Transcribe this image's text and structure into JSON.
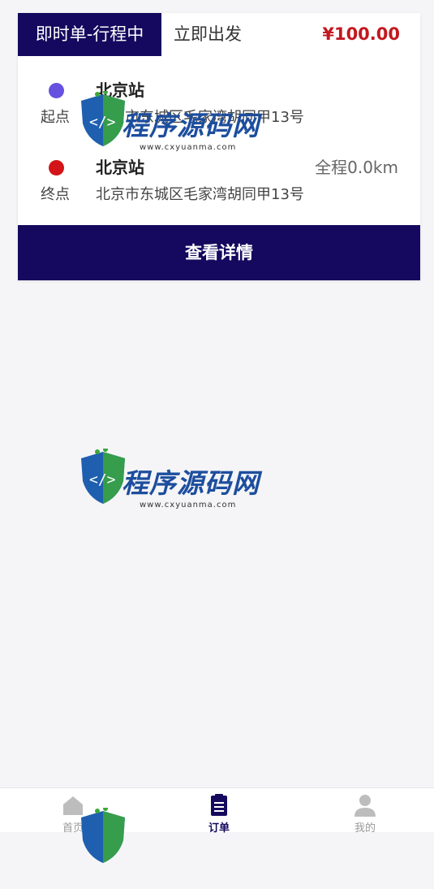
{
  "order": {
    "type_label": "即时单-行程中",
    "departure": "立即出发",
    "price": "¥100.00",
    "start": {
      "tag": "起点",
      "name": "北京站",
      "address": "北京市东城区毛家湾胡同甲13号"
    },
    "end": {
      "tag": "终点",
      "name": "北京站",
      "address": "北京市东城区毛家湾胡同甲13号",
      "distance": "全程0.0km"
    },
    "detail_button": "查看详情"
  },
  "watermark": {
    "brand": "程序源码网",
    "url": "www.cxyuanma.com"
  },
  "tabs": [
    {
      "label": "首页",
      "icon": "home-icon"
    },
    {
      "label": "订单",
      "icon": "clipboard-icon"
    },
    {
      "label": "我的",
      "icon": "user-icon"
    }
  ],
  "colors": {
    "primary": "#14095e",
    "price": "#c2191f",
    "start_dot": "#6650e0",
    "end_dot": "#d31419"
  }
}
